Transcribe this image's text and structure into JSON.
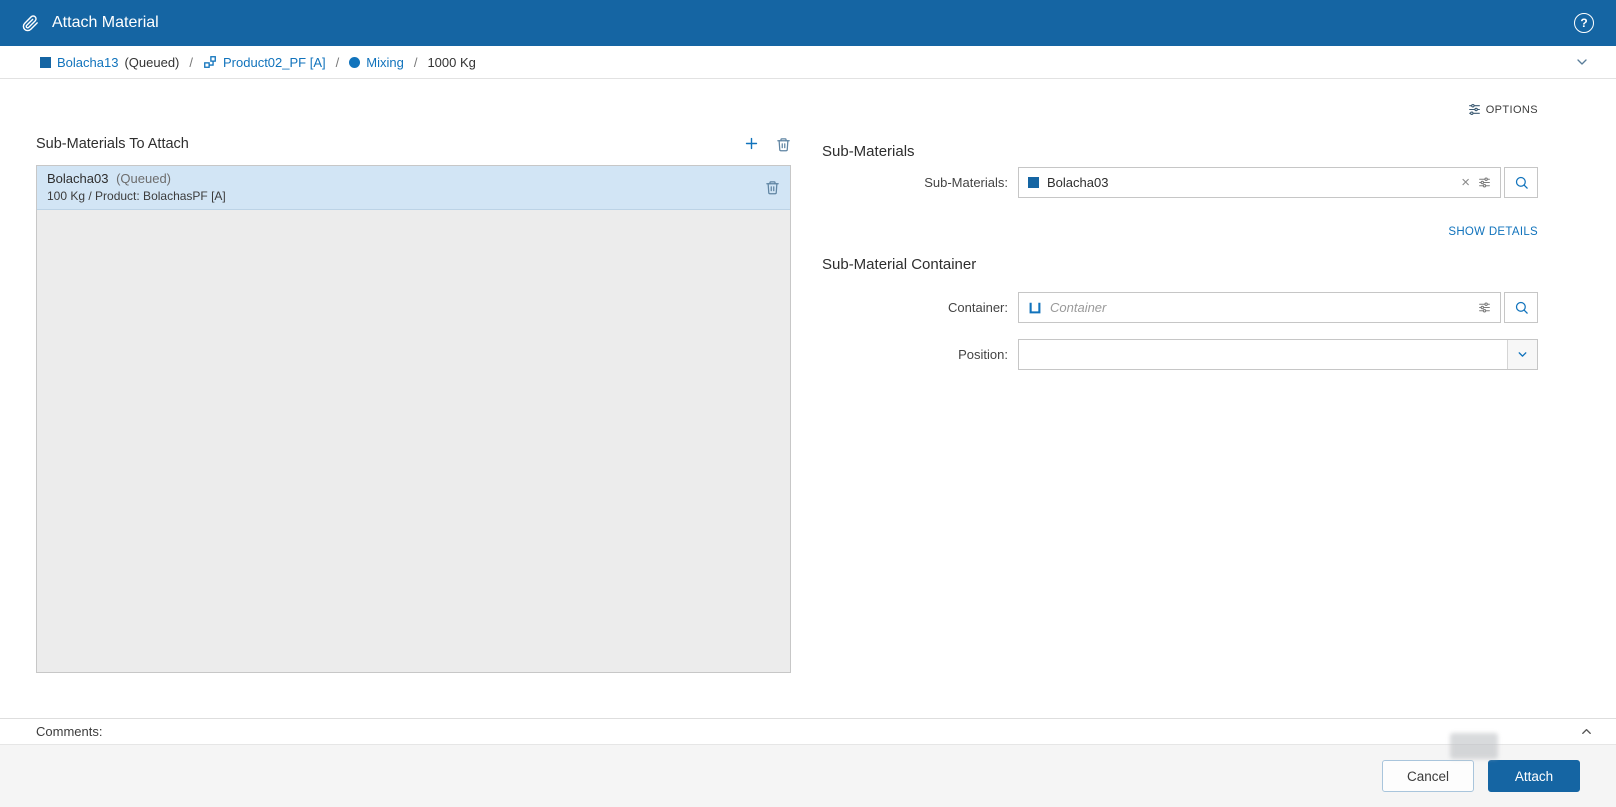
{
  "colors": {
    "header_bg": "#1565a3",
    "accent": "#1173bc",
    "selected_row_bg": "#d2e5f5"
  },
  "header": {
    "title": "Attach Material"
  },
  "breadcrumb": {
    "separator": "/",
    "items": [
      {
        "label": "Bolacha13",
        "suffix": "(Queued)"
      },
      {
        "label": "Product02_PF [A]",
        "suffix": ""
      },
      {
        "label": "Mixing",
        "suffix": ""
      },
      {
        "label": "1000 Kg",
        "suffix": ""
      }
    ]
  },
  "toolbar": {
    "options_label": "OPTIONS"
  },
  "left_panel": {
    "title": "Sub-Materials To Attach",
    "items": [
      {
        "name": "Bolacha03",
        "state": "(Queued)",
        "details": "100 Kg / Product: BolachasPF [A]"
      }
    ]
  },
  "right_panel": {
    "sub_materials": {
      "section_title": "Sub-Materials",
      "label": "Sub-Materials:",
      "value": "Bolacha03",
      "show_details_label": "SHOW DETAILS"
    },
    "container": {
      "section_title": "Sub-Material Container",
      "label": "Container:",
      "placeholder": "Container"
    },
    "position": {
      "label": "Position:",
      "value": ""
    }
  },
  "comments": {
    "label": "Comments:"
  },
  "footer": {
    "cancel_label": "Cancel",
    "attach_label": "Attach"
  }
}
